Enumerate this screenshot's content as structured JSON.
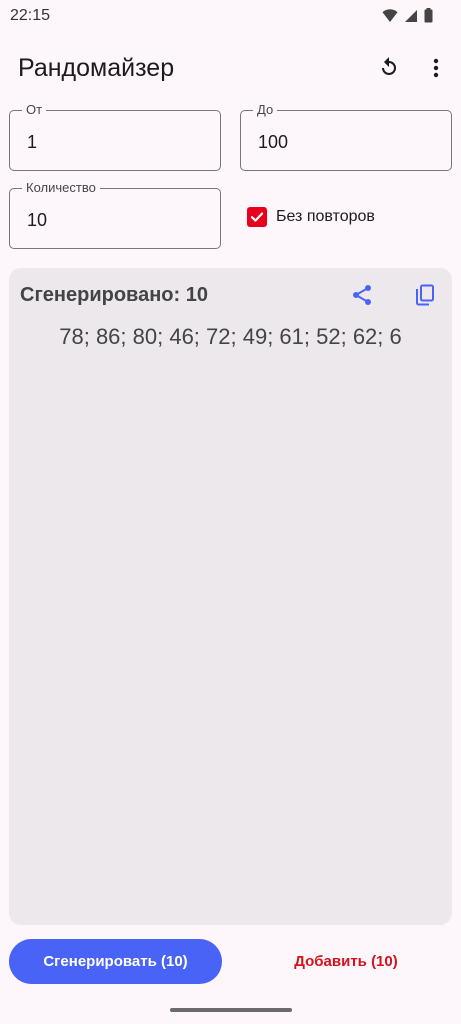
{
  "status_bar": {
    "time": "22:15"
  },
  "app_bar": {
    "title": "Рандомайзер",
    "icons": [
      "refresh-icon",
      "more-vert-icon"
    ]
  },
  "form": {
    "from": {
      "label": "От",
      "value": "1"
    },
    "to": {
      "label": "До",
      "value": "100"
    },
    "count": {
      "label": "Количество",
      "value": "10"
    },
    "no_repeats": {
      "label": "Без повторов",
      "checked": true
    }
  },
  "result": {
    "title": "Сгенерировано: 10",
    "numbers": "78; 86; 80; 46; 72; 49; 61; 52; 62; 6",
    "icons": [
      "share-icon",
      "copy-icon"
    ]
  },
  "actions": {
    "generate_label": "Сгенерировать (10)",
    "add_label": "Добавить (10)"
  },
  "colors": {
    "primary": "#4a63f7",
    "accent_red": "#d2141c",
    "checkbox": "#e8001c",
    "card_bg": "#ece8ec",
    "page_bg": "#fdf7fb"
  }
}
